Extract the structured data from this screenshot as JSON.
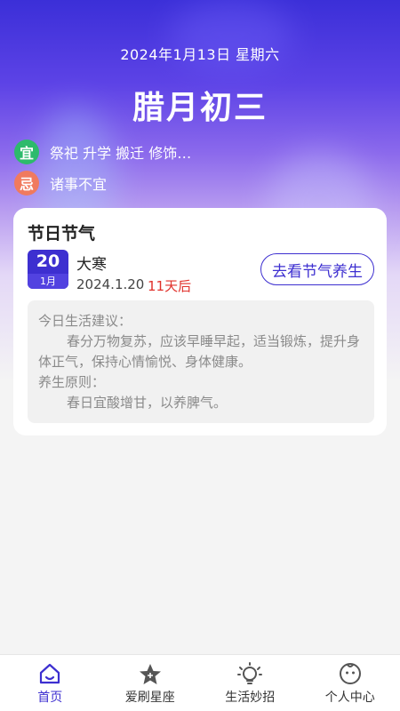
{
  "header": {
    "date_line": "2024年1月13日 星期六",
    "lunar_date": "腊月初三",
    "yi": {
      "label": "宜",
      "text": "祭祀 升学 搬迁 修饰…",
      "color": "#2dba6c"
    },
    "ji": {
      "label": "忌",
      "text": "诸事不宜",
      "color": "#f07a5e"
    }
  },
  "festival_card": {
    "title": "节日节气",
    "day": "20",
    "month": "1月",
    "term_name": "大寒",
    "term_date": "2024.1.20",
    "days_left": "11天后",
    "action_label": "去看节气养生",
    "advice": {
      "heading": "今日生活建议：",
      "body": "春分万物复苏，应该早睡早起，适当锻炼，提升身体正气，保持心情愉悦、身体健康。",
      "principle_heading": "养生原则：",
      "principle_body": "春日宜酸增甘，以养脾气。"
    }
  },
  "tabbar": {
    "items": [
      {
        "label": "首页",
        "icon": "home-icon",
        "active": true
      },
      {
        "label": "爱刷星座",
        "icon": "star-icon",
        "active": false
      },
      {
        "label": "生活妙招",
        "icon": "lightbulb-icon",
        "active": false
      },
      {
        "label": "个人中心",
        "icon": "profile-face-icon",
        "active": false
      }
    ]
  },
  "colors": {
    "accent": "#3d2fd0",
    "days_left": "#e0302a"
  }
}
